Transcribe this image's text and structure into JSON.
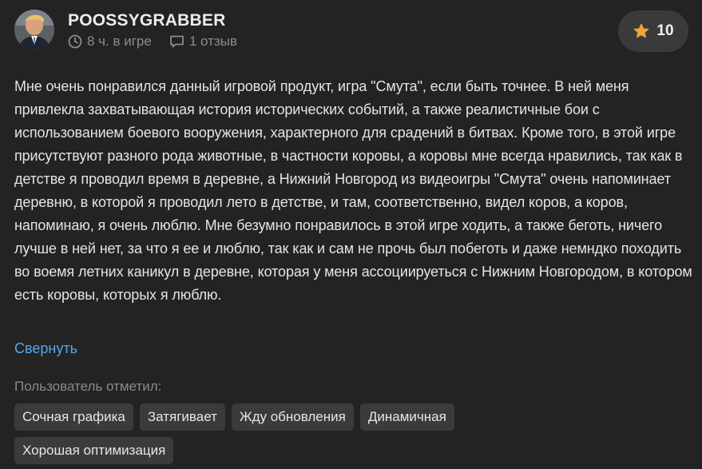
{
  "review": {
    "author": {
      "name": "POOSSYGRABBER",
      "playtime": "8 ч. в игре",
      "reviews_count": "1 отзыв",
      "avatar_icon": "user-avatar"
    },
    "rating": {
      "value": "10",
      "icon": "star-icon",
      "star_color": "#f2a33a"
    },
    "text": "Мне очень понравился данный игровой продукт, игра \"Смута\", если быть точнее. В ней меня привлекла захватывающая история исторических событий, а также реалистичные бои с использованием боевого вооружения, характерного для срадений в битвах. Кроме того, в этой игре присутствуют разного рода животные, в частности коровы, а коровы мне всегда нравились, так как в детстве я проводил время в деревне, а Нижний Новгород из видеоигры \"Смута\" очень напоминает деревню, в которой я проводил лето в детстве, и там, соответственно, видел коров, а коров, напоминаю, я очень люблю. Мне безумно понравилось в этой игре ходить, а также беготь, ничего лучше в ней нет, за что я ее и люблю, так как и сам не прочь был побеготь и даже немндко походить во воемя летних каникул в деревне, которая у меня ассоциируеться с Нижним Новгородом, в котором есть коровы, которых я люблю.",
    "collapse_label": "Свернуть",
    "tags_label": "Пользователь отметил:",
    "tags": [
      "Сочная графика",
      "Затягивает",
      "Жду обновления",
      "Динамичная",
      "Хорошая оптимизация"
    ]
  },
  "colors": {
    "background": "#232323",
    "link": "#5aa5ee",
    "tag_bg": "#3b3b3b",
    "muted": "#8c8c8c"
  }
}
